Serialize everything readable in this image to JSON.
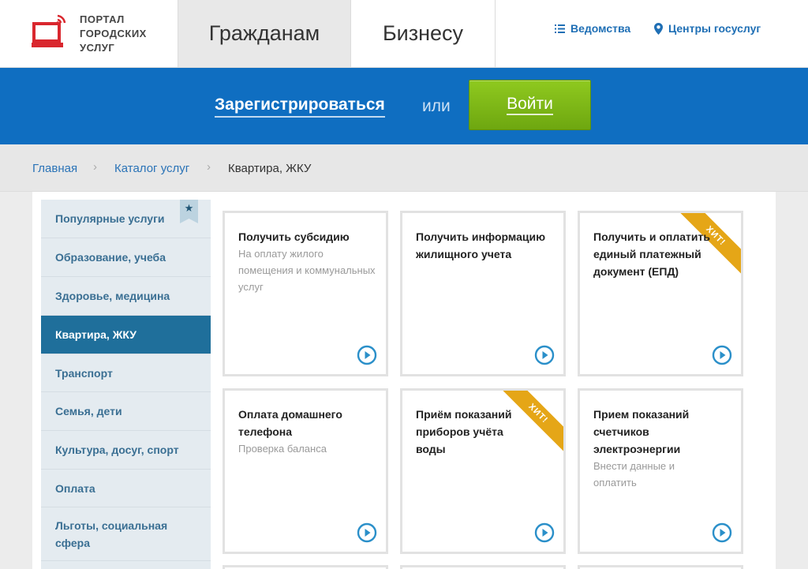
{
  "header": {
    "logo_lines": [
      "Портал",
      "городских",
      "услуг"
    ],
    "logo_icon": "laptop-signal-icon",
    "tabs": [
      {
        "label": "Гражданам",
        "active": true
      },
      {
        "label": "Бизнесу",
        "active": false
      }
    ],
    "links": [
      {
        "label": "Ведомства",
        "icon": "list-icon"
      },
      {
        "label": "Центры госуслуг",
        "icon": "location-pin-icon"
      }
    ]
  },
  "auth": {
    "register_label": "Зарегистрироваться",
    "or_label": "или",
    "login_label": "Войти"
  },
  "breadcrumb": {
    "items": [
      "Главная",
      "Каталог услуг",
      "Квартира, ЖКУ"
    ],
    "separator": "›"
  },
  "sidebar": {
    "star": "★",
    "items": [
      {
        "label": "Популярные услуги",
        "active": false
      },
      {
        "label": "Образование, учеба",
        "active": false
      },
      {
        "label": "Здоровье, медицина",
        "active": false
      },
      {
        "label": "Квартира, ЖКУ",
        "active": true
      },
      {
        "label": "Транспорт",
        "active": false
      },
      {
        "label": "Семья, дети",
        "active": false
      },
      {
        "label": "Культура, досуг, спорт",
        "active": false
      },
      {
        "label": "Оплата",
        "active": false
      },
      {
        "label": "Льготы, социальная сфера",
        "active": false
      }
    ]
  },
  "cards": [
    {
      "title": "Получить субсидию",
      "desc": "На оплату жилого помещения и коммунальных услуг",
      "ribbon": ""
    },
    {
      "title": "Получить информацию жилищного учета",
      "desc": "",
      "ribbon": ""
    },
    {
      "title": "Получить и оплатить единый платежный документ (ЕПД)",
      "desc": "",
      "ribbon": "ХИТ!"
    },
    {
      "title": "Оплата домашнего телефона",
      "desc": "Проверка баланса",
      "ribbon": ""
    },
    {
      "title": "Приём показаний приборов учёта воды",
      "desc": "",
      "ribbon": "ХИТ!"
    },
    {
      "title": "Прием показаний счетчиков электроэнергии",
      "desc": "Внести данные и оплатить",
      "ribbon": ""
    }
  ],
  "colors": {
    "brand_blue": "#0f6ec1",
    "login_green": "#7bb516",
    "active_sidebar": "#1f6f9b",
    "ribbon_gold": "#e5a617",
    "logo_red": "#d9272e"
  }
}
